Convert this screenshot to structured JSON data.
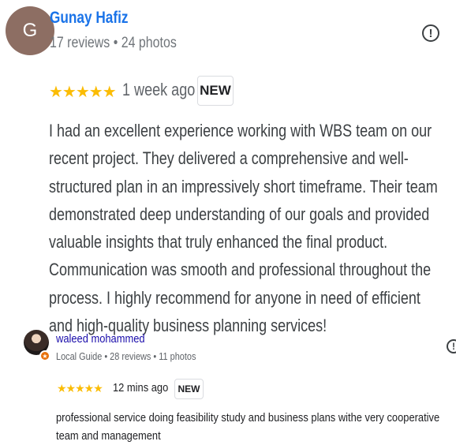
{
  "reviews": [
    {
      "author": "Gunay Hafiz",
      "avatar_letter": "G",
      "meta": "17 reviews • 24 photos",
      "rating": 5,
      "stars": "★★★★★",
      "time": "1 week ago",
      "badge": "NEW",
      "text": "I had an excellent experience working with WBS team on our recent project. They delivered a comprehensive and well-structured plan in an impressively short timeframe. Their team demonstrated deep understanding of our goals and provided valuable insights that truly enhanced the final product. Communication was smooth and professional throughout the process. I highly recommend for anyone in need of efficient and high-quality business planning services!",
      "report_icon": "report-flag-icon"
    },
    {
      "author": "waleed mohammed",
      "meta": "Local Guide • 28 reviews • 11 photos",
      "rating": 5,
      "stars": "★★★★★",
      "time": "12 mins ago",
      "badge": "NEW",
      "text": "professional service doing feasibility study and business plans withe very cooperative team and management",
      "report_icon": "report-flag-icon"
    }
  ],
  "colors": {
    "star": "#fbbc04",
    "name_link_1": "#1a73e8",
    "name_link_2": "#1a0dab",
    "avatar_bg": "#8d6e63",
    "local_guide_badge": "#e8710a"
  }
}
